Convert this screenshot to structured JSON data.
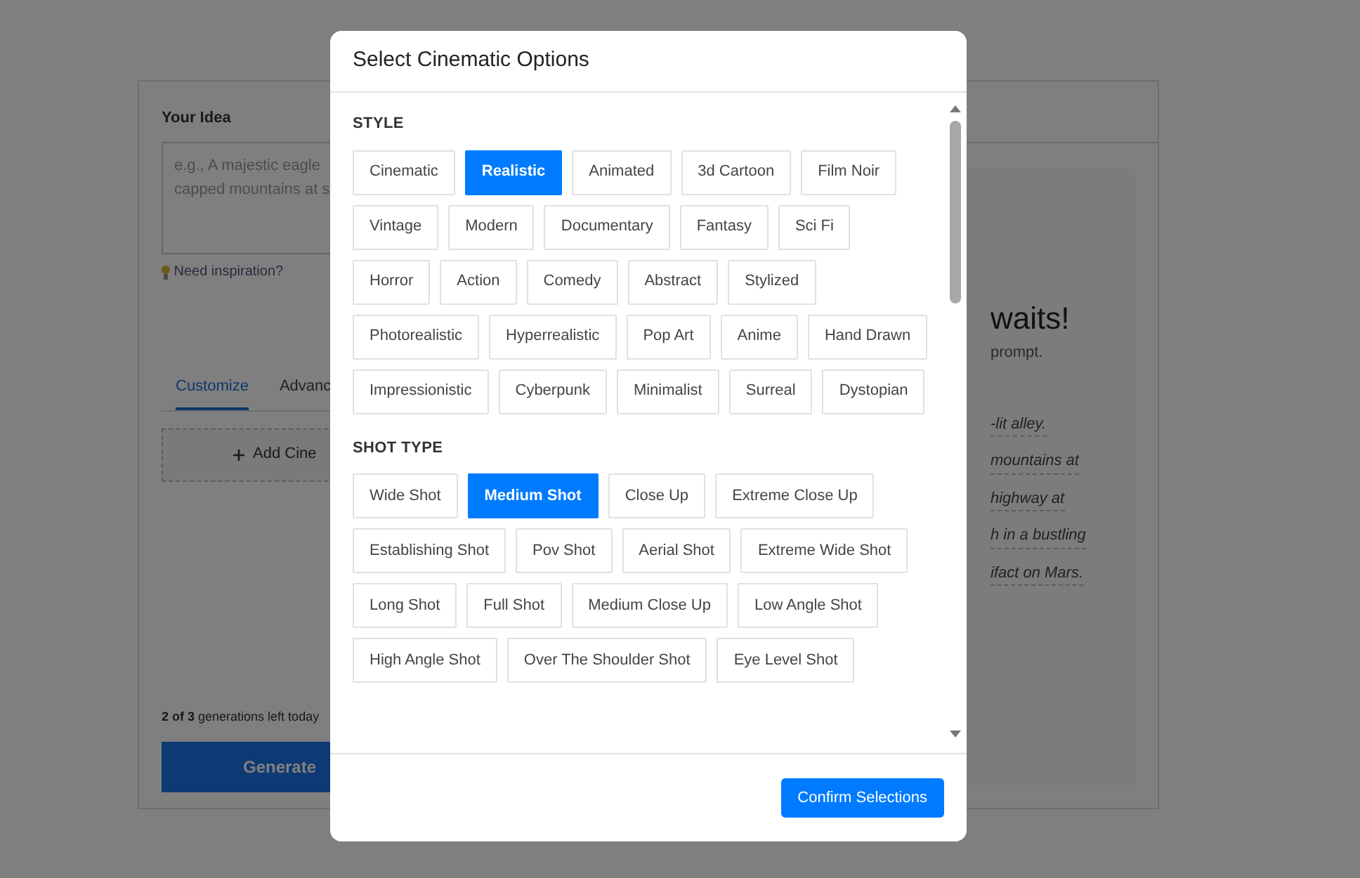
{
  "background": {
    "idea_label": "Your Idea",
    "idea_placeholder_lines": [
      "e.g., A majestic eagle",
      "capped mountains at s"
    ],
    "inspiration_link": "Need inspiration?",
    "tabs": [
      {
        "label": "Customize",
        "selected": true
      },
      {
        "label": "Advanc",
        "selected": false
      }
    ],
    "add_button": "Add Cine",
    "quota": {
      "bold": "2 of 3",
      "rest": "generations left today"
    },
    "generate_button": "Generate",
    "heading": "waits!",
    "subheading": "prompt.",
    "examples": [
      "-lit alley.",
      "mountains at",
      "highway at",
      "h in a bustling",
      "ifact on Mars."
    ]
  },
  "modal": {
    "title": "Select Cinematic Options",
    "sections": [
      {
        "title": "STYLE",
        "options": [
          {
            "label": "Cinematic",
            "selected": false
          },
          {
            "label": "Realistic",
            "selected": true
          },
          {
            "label": "Animated",
            "selected": false
          },
          {
            "label": "3d Cartoon",
            "selected": false
          },
          {
            "label": "Film Noir",
            "selected": false
          },
          {
            "label": "Vintage",
            "selected": false
          },
          {
            "label": "Modern",
            "selected": false
          },
          {
            "label": "Documentary",
            "selected": false
          },
          {
            "label": "Fantasy",
            "selected": false
          },
          {
            "label": "Sci Fi",
            "selected": false
          },
          {
            "label": "Horror",
            "selected": false
          },
          {
            "label": "Action",
            "selected": false
          },
          {
            "label": "Comedy",
            "selected": false
          },
          {
            "label": "Abstract",
            "selected": false
          },
          {
            "label": "Stylized",
            "selected": false
          },
          {
            "label": "Photorealistic",
            "selected": false
          },
          {
            "label": "Hyperrealistic",
            "selected": false
          },
          {
            "label": "Pop Art",
            "selected": false
          },
          {
            "label": "Anime",
            "selected": false
          },
          {
            "label": "Hand Drawn",
            "selected": false
          },
          {
            "label": "Impressionistic",
            "selected": false
          },
          {
            "label": "Cyberpunk",
            "selected": false
          },
          {
            "label": "Minimalist",
            "selected": false
          },
          {
            "label": "Surreal",
            "selected": false
          },
          {
            "label": "Dystopian",
            "selected": false
          }
        ]
      },
      {
        "title": "SHOT TYPE",
        "options": [
          {
            "label": "Wide Shot",
            "selected": false
          },
          {
            "label": "Medium Shot",
            "selected": true
          },
          {
            "label": "Close Up",
            "selected": false
          },
          {
            "label": "Extreme Close Up",
            "selected": false
          },
          {
            "label": "Establishing Shot",
            "selected": false
          },
          {
            "label": "Pov Shot",
            "selected": false
          },
          {
            "label": "Aerial Shot",
            "selected": false
          },
          {
            "label": "Extreme Wide Shot",
            "selected": false
          },
          {
            "label": "Long Shot",
            "selected": false
          },
          {
            "label": "Full Shot",
            "selected": false
          },
          {
            "label": "Medium Close Up",
            "selected": false
          },
          {
            "label": "Low Angle Shot",
            "selected": false
          },
          {
            "label": "High Angle Shot",
            "selected": false
          },
          {
            "label": "Over The Shoulder Shot",
            "selected": false
          },
          {
            "label": "Eye Level Shot",
            "selected": false
          }
        ]
      }
    ],
    "confirm_button": "Confirm Selections"
  }
}
